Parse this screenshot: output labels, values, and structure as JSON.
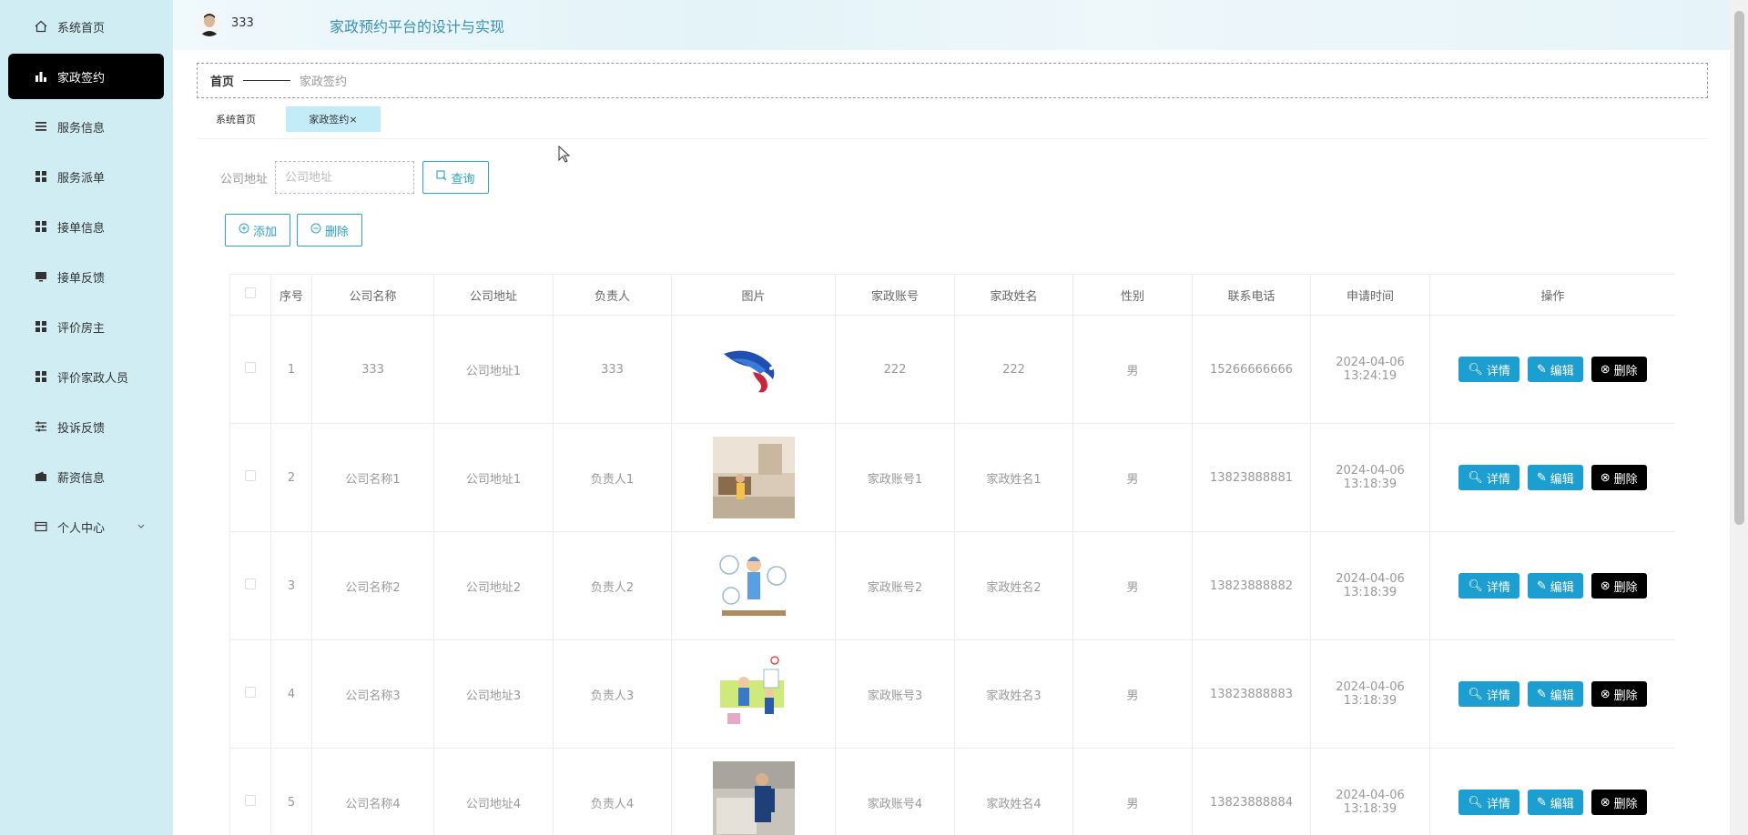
{
  "sidebar": {
    "items": [
      {
        "label": "系统首页",
        "icon": "home-icon"
      },
      {
        "label": "家政签约",
        "icon": "bar-chart-icon"
      },
      {
        "label": "服务信息",
        "icon": "list-icon"
      },
      {
        "label": "服务派单",
        "icon": "grid-icon"
      },
      {
        "label": "接单信息",
        "icon": "grid-icon"
      },
      {
        "label": "接单反馈",
        "icon": "monitor-icon"
      },
      {
        "label": "评价房主",
        "icon": "grid-icon"
      },
      {
        "label": "评价家政人员",
        "icon": "grid-icon"
      },
      {
        "label": "投诉反馈",
        "icon": "sliders-icon"
      },
      {
        "label": "薪资信息",
        "icon": "wallet-icon"
      },
      {
        "label": "个人中心",
        "icon": "card-icon"
      }
    ]
  },
  "header": {
    "username": "333",
    "site_title": "家政预约平台的设计与实现"
  },
  "breadcrumb": {
    "home": "首页",
    "current": "家政签约"
  },
  "tabs": [
    {
      "label": "系统首页"
    },
    {
      "label": "家政签约×"
    }
  ],
  "search": {
    "label": "公司地址",
    "placeholder": "公司地址",
    "button": "查询"
  },
  "toolbar": {
    "add": "添加",
    "delete": "删除"
  },
  "table": {
    "headers": [
      "序号",
      "公司名称",
      "公司地址",
      "负责人",
      "图片",
      "家政账号",
      "家政姓名",
      "性别",
      "联系电话",
      "申请时间",
      "操作"
    ],
    "rows": [
      {
        "no": "1",
        "company": "333",
        "address": "公司地址1",
        "manager": "333",
        "account": "222",
        "name": "222",
        "gender": "男",
        "phone": "15266666666",
        "time": "2024-04-06 13:24:19"
      },
      {
        "no": "2",
        "company": "公司名称1",
        "address": "公司地址1",
        "manager": "负责人1",
        "account": "家政账号1",
        "name": "家政姓名1",
        "gender": "男",
        "phone": "13823888881",
        "time": "2024-04-06 13:18:39"
      },
      {
        "no": "3",
        "company": "公司名称2",
        "address": "公司地址2",
        "manager": "负责人2",
        "account": "家政账号2",
        "name": "家政姓名2",
        "gender": "男",
        "phone": "13823888882",
        "time": "2024-04-06 13:18:39"
      },
      {
        "no": "4",
        "company": "公司名称3",
        "address": "公司地址3",
        "manager": "负责人3",
        "account": "家政账号3",
        "name": "家政姓名3",
        "gender": "男",
        "phone": "13823888883",
        "time": "2024-04-06 13:18:39"
      },
      {
        "no": "5",
        "company": "公司名称4",
        "address": "公司地址4",
        "manager": "负责人4",
        "account": "家政账号4",
        "name": "家政姓名4",
        "gender": "男",
        "phone": "13823888884",
        "time": "2024-04-06 13:18:39"
      }
    ],
    "ops": {
      "detail": "详情",
      "edit": "编辑",
      "delete": "删除"
    }
  },
  "colors": {
    "sidebar_bg": "#cfedf3",
    "active_menu": "#000000",
    "accent": "#1d9ed1",
    "title": "#3a8fb8"
  }
}
